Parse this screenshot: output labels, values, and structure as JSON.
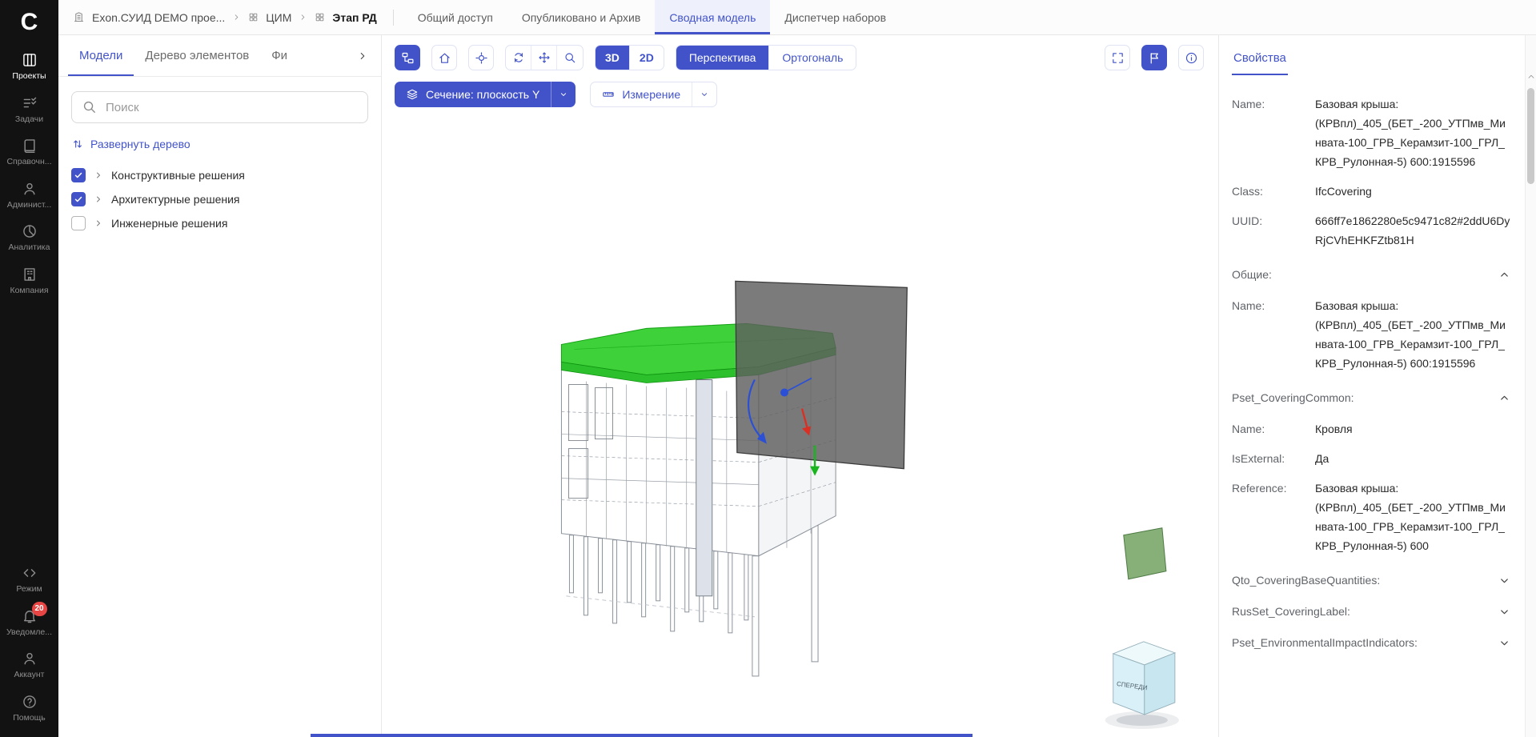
{
  "colors": {
    "primary": "#4253c9",
    "roof_green": "#3ed13a",
    "badge_red": "#e84545",
    "plane_gray": "#5e5e5e"
  },
  "sidebar": {
    "logo_letter": "C",
    "items": [
      {
        "label": "Проекты",
        "active": true
      },
      {
        "label": "Задачи",
        "active": false
      },
      {
        "label": "Справочн...",
        "active": false
      },
      {
        "label": "Админист...",
        "active": false
      },
      {
        "label": "Аналитика",
        "active": false
      },
      {
        "label": "Компания",
        "active": false
      }
    ],
    "bottom_items": [
      {
        "label": "Режим"
      },
      {
        "label": "Уведомле...",
        "badge": "20"
      },
      {
        "label": "Аккаунт"
      },
      {
        "label": "Помощь"
      }
    ]
  },
  "topbar": {
    "breadcrumb": [
      {
        "label": "Exon.СУИД DEMO прое..."
      },
      {
        "label": "ЦИМ"
      },
      {
        "label": "Этап РД"
      }
    ],
    "tabs": [
      {
        "label": "Общий доступ",
        "active": false
      },
      {
        "label": "Опубликовано и Архив",
        "active": false
      },
      {
        "label": "Сводная модель",
        "active": true
      },
      {
        "label": "Диспетчер наборов",
        "active": false
      }
    ]
  },
  "left_panel": {
    "tabs": [
      {
        "label": "Модели",
        "active": true
      },
      {
        "label": "Дерево элементов",
        "active": false
      },
      {
        "label": "Фи",
        "active": false
      }
    ],
    "search_placeholder": "Поиск",
    "expand_tree_label": "Развернуть дерево",
    "tree": [
      {
        "label": "Конструктивные решения",
        "checked": true
      },
      {
        "label": "Архитектурные решения",
        "checked": true
      },
      {
        "label": "Инженерные решения",
        "checked": false
      }
    ]
  },
  "viewer": {
    "toolbar": {
      "mode_3d": "3D",
      "mode_2d": "2D",
      "perspective": "Перспектива",
      "orthogonal": "Ортогональ",
      "section_label": "Сечение: плоскость Y",
      "measure_label": "Измерение"
    },
    "nav_cube_front": "СПЕРЕДИ"
  },
  "properties": {
    "title": "Свойства",
    "entries": [
      {
        "label": "Name:",
        "value": "Базовая крыша: (КРВпл)_405_(БЕТ_-200_УТПмв_Минвата-100_ГРВ_Керамзит-100_ГРЛ_КРВ_Рулонная-5) 600:1915596"
      },
      {
        "label": "Class:",
        "value": "IfcCovering"
      },
      {
        "label": "UUID:",
        "value": "666ff7e1862280e5c9471c82#2ddU6DyRjCVhEHKFZtb81H"
      },
      {
        "label": "Общие:",
        "expanded": true
      },
      {
        "label": "Name:",
        "value": "Базовая крыша: (КРВпл)_405_(БЕТ_-200_УТПмв_Минвата-100_ГРВ_Керамзит-100_ГРЛ_КРВ_Рулонная-5) 600:1915596"
      },
      {
        "label": "Pset_CoveringCommon:",
        "expanded": true
      },
      {
        "label": "Name:",
        "value": "Кровля"
      },
      {
        "label": "IsExternal:",
        "value": "Да"
      },
      {
        "label": "Reference:",
        "value": "Базовая крыша: (КРВпл)_405_(БЕТ_-200_УТПмв_Минвата-100_ГРВ_Керамзит-100_ГРЛ_КРВ_Рулонная-5) 600"
      },
      {
        "label": "Qto_CoveringBaseQuantities:",
        "expanded": false
      },
      {
        "label": "RusSet_CoveringLabel:",
        "expanded": false
      },
      {
        "label": "Pset_EnvironmentalImpactIndicators:",
        "expanded": false
      }
    ]
  }
}
